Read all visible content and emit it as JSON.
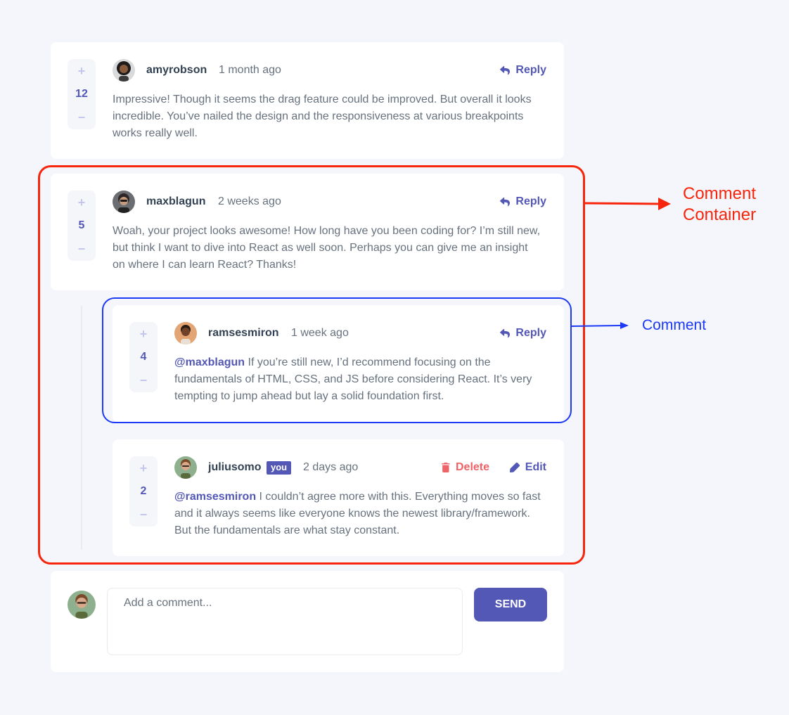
{
  "comments": [
    {
      "score": "12",
      "username": "amyrobson",
      "created": "1 month ago",
      "reply_label": "Reply",
      "text": "Impressive! Though it seems the drag feature could be improved. But overall it looks incredible. You’ve nailed the design and the responsiveness at various breakpoints works really well.",
      "avatar_colors": {
        "bg": "#d9dadb",
        "skin": "#8a5a3c",
        "hair": "#1e1b1a"
      }
    },
    {
      "score": "5",
      "username": "maxblagun",
      "created": "2 weeks ago",
      "reply_label": "Reply",
      "text": "Woah, your project looks awesome! How long have you been coding for? I’m still new, but think I want to dive into React as well soon. Perhaps you can give me an insight on where I can learn React? Thanks!",
      "avatar_colors": {
        "bg": "#6b6e70",
        "skin": "#c49a7e",
        "hair": "#2c2624"
      }
    }
  ],
  "replies": [
    {
      "score": "4",
      "username": "ramsesmiron",
      "created": "1 week ago",
      "reply_label": "Reply",
      "mention": "@maxblagun",
      "text": " If you’re still new, I’d recommend focusing on the fundamentals of HTML, CSS, and JS before considering React. It’s very tempting to jump ahead but lay a solid foundation first.",
      "avatar_colors": {
        "bg": "#e3a574",
        "skin": "#6e4128",
        "hair": "#2a1b14"
      }
    },
    {
      "score": "2",
      "username": "juliusomo",
      "you_badge": "you",
      "created": "2 days ago",
      "delete_label": "Delete",
      "edit_label": "Edit",
      "mention": "@ramsesmiron",
      "text": " I couldn’t agree more with this. Everything moves so fast and it always seems like everyone knows the newest library/framework. But the fundamentals are what stay constant.",
      "avatar_colors": {
        "bg": "#8fb08e",
        "skin": "#d7a98a",
        "hair": "#7a4b2a"
      }
    }
  ],
  "vote_icons": {
    "plus": "+",
    "minus": "−"
  },
  "new_comment": {
    "placeholder": "Add a comment...",
    "send_label": "SEND"
  },
  "annotations": {
    "comment_container_line1": "Comment",
    "comment_container_line2": "Container",
    "comment": "Comment"
  },
  "colors": {
    "accent": "#5357b6",
    "danger": "#ed6368",
    "annotation_red": "#f7250b",
    "annotation_blue": "#1c39f5"
  }
}
